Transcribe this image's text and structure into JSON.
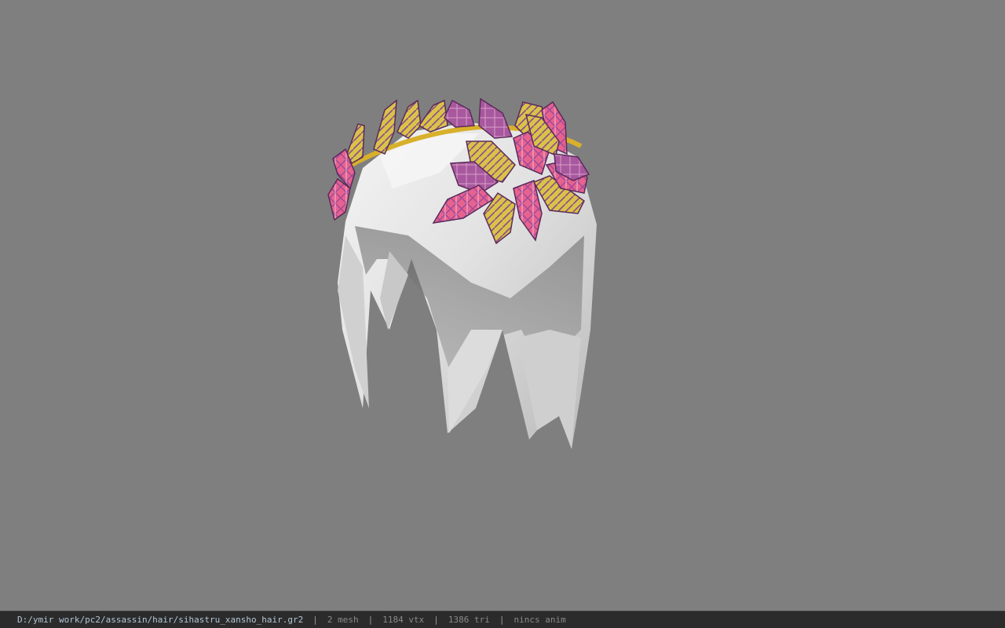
{
  "viewport": {
    "background_color": "#7f7f7f",
    "model_name": "sihastru_xansho_hair",
    "hair_color": "#e8e8e8",
    "leaf_colors": [
      "#e8628e",
      "#9a4a9a",
      "#d9c24a",
      "#f0b8d0"
    ],
    "wreath_color": "#d8b02a"
  },
  "status": {
    "file_path": "D:/ymir work/pc2/assassin/hair/sihastru_xansho_hair.gr2",
    "sep1": "|",
    "mesh": "2 mesh",
    "sep2": "|",
    "vertices": "1184 vtx",
    "sep3": "|",
    "triangles": "1386 tri",
    "sep4": "|",
    "anim": "nincs anim"
  }
}
